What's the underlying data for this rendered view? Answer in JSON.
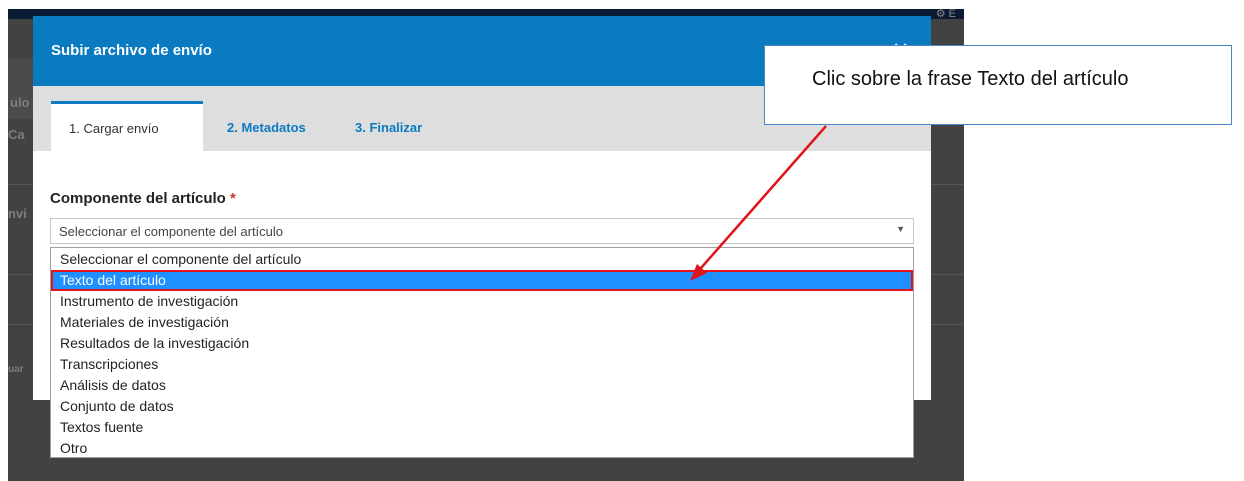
{
  "background": {
    "topbar_right": "⚙ E",
    "fragments": [
      "ulo",
      "Ca",
      "nvi",
      "uar"
    ]
  },
  "modal": {
    "title": "Subir archivo de envío",
    "close_symbol": "✕",
    "tabs": [
      {
        "label": "1. Cargar envío",
        "active": true
      },
      {
        "label": "2. Metadatos",
        "active": false
      },
      {
        "label": "3. Finalizar",
        "active": false
      }
    ],
    "field": {
      "label": "Componente del artículo",
      "required_marker": "*",
      "selected_value": "Seleccionar el componente del artículo",
      "arrow": "▼"
    }
  },
  "dropdown": {
    "options": [
      "Seleccionar el componente del artículo",
      "Texto del artículo",
      "Instrumento de investigación",
      "Materiales de investigación",
      "Resultados de la investigación",
      "Transcripciones",
      "Análisis de datos",
      "Conjunto de datos",
      "Textos fuente",
      "Otro"
    ],
    "highlighted": "Texto del artículo"
  },
  "callout": {
    "text": "Clic sobre la frase Texto del artículo"
  },
  "colors": {
    "accent": "#0a7ac1",
    "highlight": "#1e90ff",
    "annotation": "#e0141a"
  }
}
